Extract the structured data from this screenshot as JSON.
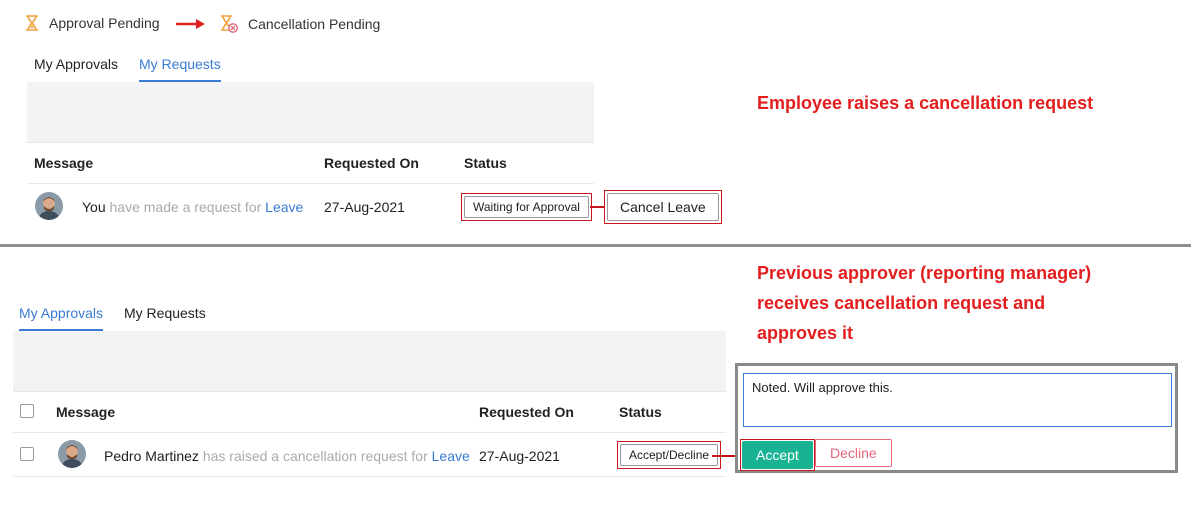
{
  "legend": {
    "approval_pending": "Approval Pending",
    "cancellation_pending": "Cancellation Pending"
  },
  "top": {
    "tabs": [
      "My Approvals",
      "My Requests"
    ],
    "active_tab": "My Requests",
    "headers": {
      "message": "Message",
      "requested_on": "Requested On",
      "status": "Status"
    },
    "row": {
      "actor": "You",
      "text": " have made a request for ",
      "link": "Leave",
      "date": "27-Aug-2021",
      "status": "Waiting for Approval",
      "action": "Cancel Leave"
    },
    "annotation": "Employee raises a cancellation request"
  },
  "bottom": {
    "tabs": [
      "My Approvals",
      "My Requests"
    ],
    "active_tab": "My Approvals",
    "headers": {
      "message": "Message",
      "requested_on": "Requested On",
      "status": "Status"
    },
    "row": {
      "actor": "Pedro Martinez",
      "text": " has raised a cancellation request for ",
      "link": "Leave",
      "date": "27-Aug-2021",
      "status": "Accept/Decline"
    },
    "annotation_lines": [
      "Previous approver (reporting manager)",
      "receives cancellation request and",
      "approves it"
    ],
    "comment": "Noted. Will approve this.",
    "accept": "Accept",
    "decline": "Decline"
  },
  "colors": {
    "accent": "#3a7bd5",
    "annotation_red": "#e31e1e",
    "accept_green": "#19b394",
    "decline_pink": "#e4667b",
    "hourglass_orange": "#f0a23b"
  },
  "icons": {
    "approval_pending": "hourglass-icon",
    "cancellation_pending": "hourglass-cancel-icon",
    "arrow": "arrow-right-icon"
  }
}
